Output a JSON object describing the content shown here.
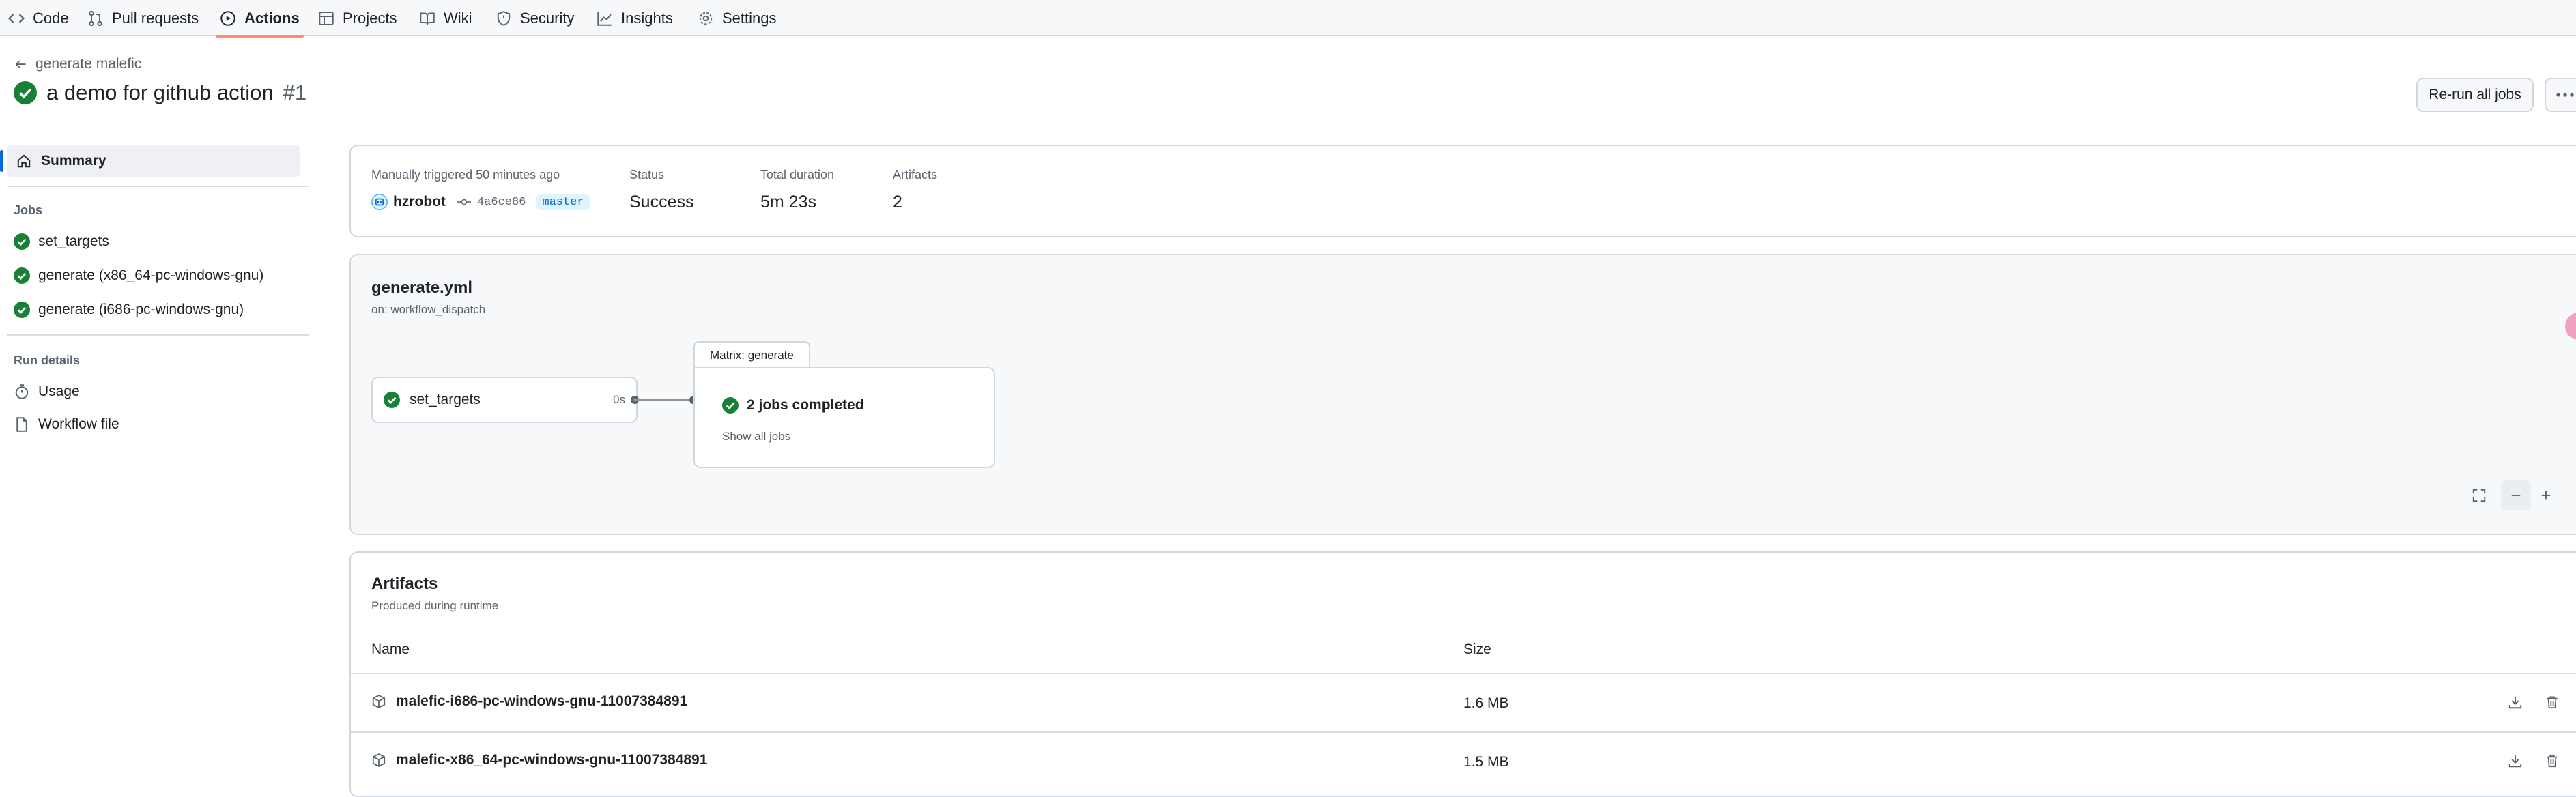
{
  "nav": {
    "tabs": [
      {
        "label": "Code",
        "icon": "code-icon"
      },
      {
        "label": "Pull requests",
        "icon": "pull-request-icon"
      },
      {
        "label": "Actions",
        "icon": "play-circle-icon",
        "active": true
      },
      {
        "label": "Projects",
        "icon": "table-icon"
      },
      {
        "label": "Wiki",
        "icon": "book-icon"
      },
      {
        "label": "Security",
        "icon": "shield-icon"
      },
      {
        "label": "Insights",
        "icon": "graph-icon"
      },
      {
        "label": "Settings",
        "icon": "gear-icon"
      }
    ]
  },
  "header": {
    "back_label": "generate malefic",
    "title": "a demo for github action",
    "run_number": "#1",
    "rerun_label": "Re-run all jobs"
  },
  "sidebar": {
    "summary_label": "Summary",
    "jobs_heading": "Jobs",
    "jobs": [
      {
        "label": "set_targets",
        "status": "success"
      },
      {
        "label": "generate (x86_64-pc-windows-gnu)",
        "status": "success"
      },
      {
        "label": "generate (i686-pc-windows-gnu)",
        "status": "success"
      }
    ],
    "run_details_heading": "Run details",
    "run_details": [
      {
        "label": "Usage",
        "icon": "stopwatch-icon"
      },
      {
        "label": "Workflow file",
        "icon": "file-icon"
      }
    ]
  },
  "summary": {
    "trigger_label": "Manually triggered 50 minutes ago",
    "actor": "hzrobot",
    "commit_sha": "4a6ce86",
    "branch": "master",
    "status_label": "Status",
    "status_value": "Success",
    "duration_label": "Total duration",
    "duration_value": "5m 23s",
    "artifacts_label": "Artifacts",
    "artifacts_value": "2"
  },
  "workflow": {
    "name": "generate.yml",
    "trigger": "on: workflow_dispatch",
    "job": {
      "label": "set_targets",
      "duration": "0s"
    },
    "matrix": {
      "tab_label": "Matrix: generate",
      "status_label": "2 jobs completed",
      "show_all_label": "Show all jobs"
    }
  },
  "artifacts": {
    "title": "Artifacts",
    "subtitle": "Produced during runtime",
    "col_name": "Name",
    "col_size": "Size",
    "rows": [
      {
        "name": "malefic-i686-pc-windows-gnu-11007384891",
        "size": "1.6 MB"
      },
      {
        "name": "malefic-x86_64-pc-windows-gnu-11007384891",
        "size": "1.5 MB"
      }
    ]
  },
  "colors": {
    "success": "#1a7f37",
    "accent": "#0969da",
    "active_tab_underline": "#fd8c73"
  }
}
